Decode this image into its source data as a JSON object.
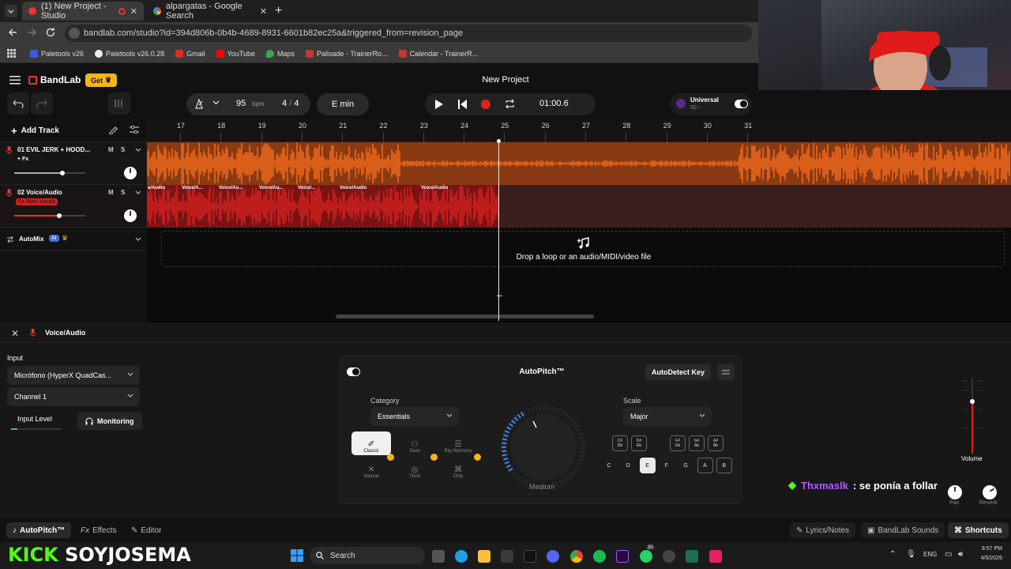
{
  "browser": {
    "tabs": [
      {
        "label": "(1) New Project - Studio",
        "active": true
      },
      {
        "label": "alpargatas - Google Search",
        "active": false
      }
    ],
    "url": "bandlab.com/studio?id=394d806b-0b4b-4689-8931-6601b82ec25a&triggered_from=revision_page",
    "bookmarks": [
      "Paletools v26",
      "Paletools v26.0.28",
      "Gmail",
      "YouTube",
      "Maps",
      "Palisade - TrainerRo...",
      "Calendar - TrainerR..."
    ]
  },
  "app": {
    "brand": "BandLab",
    "get_label": "Get",
    "project_title": "New Project",
    "bpm": "95",
    "bpm_unit": "bpm",
    "time_signature_num": "4",
    "time_signature_sep": "/",
    "time_signature_den": "4",
    "key": "E min",
    "time": "01:00.6",
    "universal_label": "Universal",
    "universal_sub": "50 ›",
    "add_track": "Add Track",
    "ruler": [
      "17",
      "18",
      "19",
      "20",
      "21",
      "22",
      "23",
      "24",
      "25",
      "26",
      "27",
      "28",
      "29",
      "30",
      "31"
    ],
    "tracks": [
      {
        "name": "01 EVIL JERK + HOOD...",
        "sub": "+ Fx",
        "m": "M",
        "s": "S",
        "level": 0.68
      },
      {
        "name": "02 Voice/Audio",
        "sub": "Fx Main Vocals",
        "m": "M",
        "s": "S",
        "level": 0.63
      }
    ],
    "clips": [
      "e/Audio",
      "Voice/A...",
      "Voice/Au...",
      "Voice/Au...",
      "Voice/...",
      "Voice/Audio",
      "Voice/Audio"
    ],
    "automix": "AutoMix",
    "automix_badge": "AI",
    "drop_text": "Drop a loop or an audio/MIDI/video file"
  },
  "panel": {
    "track_title": "Voice/Audio",
    "input_label": "Input",
    "input_device": "Micrófono (HyperX QuadCas...",
    "channel": "Channel 1",
    "input_level_label": "Input Level",
    "monitoring": "Monitoring",
    "fx_title": "AutoPitch™",
    "autodetect": "AutoDetect Key",
    "category_label": "Category",
    "category_value": "Essentials",
    "presets": [
      "Classic",
      "Duet",
      "Big Harmony",
      "Natural",
      "Third",
      "Chip"
    ],
    "amount_label": "Medium",
    "scale_label": "Scale",
    "scale_value": "Major",
    "keys_natural": [
      "C",
      "D",
      "E",
      "F",
      "G",
      "A",
      "B"
    ],
    "selected_key": "E",
    "accidentals": [
      {
        "top": "C#",
        "bot": "Db"
      },
      {
        "top": "D#",
        "bot": "Eb"
      },
      {
        "top": "F#",
        "bot": "Gb"
      },
      {
        "top": "G#",
        "bot": "Ab"
      },
      {
        "top": "A#",
        "bot": "Bb"
      }
    ],
    "volume_label": "Volume",
    "pan_label": "Pan",
    "reverb_label": "Reverb"
  },
  "bottom": {
    "autopitch_tab": "AutoPitch™",
    "effects_tab": "Effects",
    "editor_tab": "Editor",
    "lyrics": "Lyrics/Notes",
    "sounds": "BandLab Sounds",
    "shortcuts": "Shortcuts"
  },
  "overlay": {
    "kick_k": "KICK",
    "kick_name": "SOYJOSEMA",
    "chat_user": "Thxmaslk",
    "chat_msg": ": se ponía a follar"
  },
  "taskbar": {
    "search": "Search",
    "lang": "ENG",
    "time": "9:57 PM",
    "date": "4/5/2026",
    "notif_badge": "30"
  },
  "colors": {
    "accent_orange": "#f26b1d",
    "clip_red": "#d42020",
    "kick_green": "#53fc18",
    "get_yellow": "#f3b51b"
  }
}
